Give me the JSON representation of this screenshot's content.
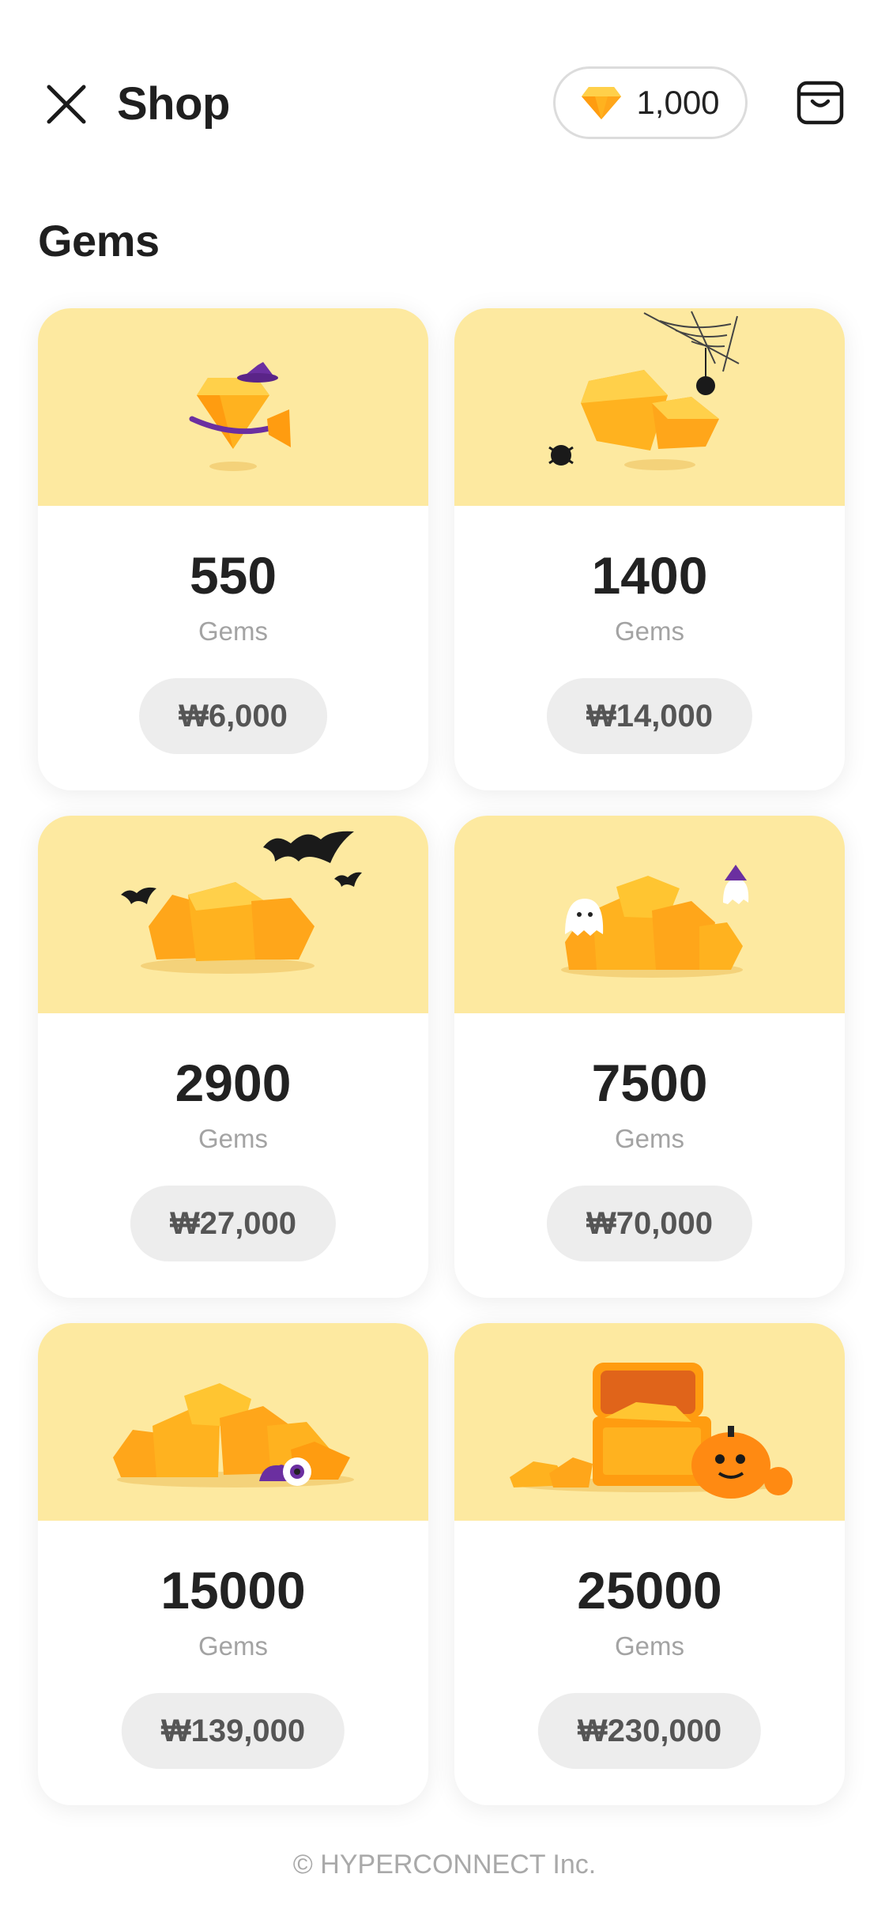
{
  "header": {
    "title": "Shop",
    "balance": "1,000"
  },
  "section": {
    "title": "Gems"
  },
  "products": [
    {
      "amount": "550",
      "unit": "Gems",
      "price": "₩6,000"
    },
    {
      "amount": "1400",
      "unit": "Gems",
      "price": "₩14,000"
    },
    {
      "amount": "2900",
      "unit": "Gems",
      "price": "₩27,000"
    },
    {
      "amount": "7500",
      "unit": "Gems",
      "price": "₩70,000"
    },
    {
      "amount": "15000",
      "unit": "Gems",
      "price": "₩139,000"
    },
    {
      "amount": "25000",
      "unit": "Gems",
      "price": "₩230,000"
    }
  ],
  "footer": {
    "copyright": "© HYPERCONNECT Inc."
  },
  "colors": {
    "card_art_bg": "#fde9a0",
    "gem": "#ffb21f",
    "price_bg": "#ededed"
  },
  "icons": [
    "close-icon",
    "gem-icon",
    "shopping-bag-icon"
  ]
}
